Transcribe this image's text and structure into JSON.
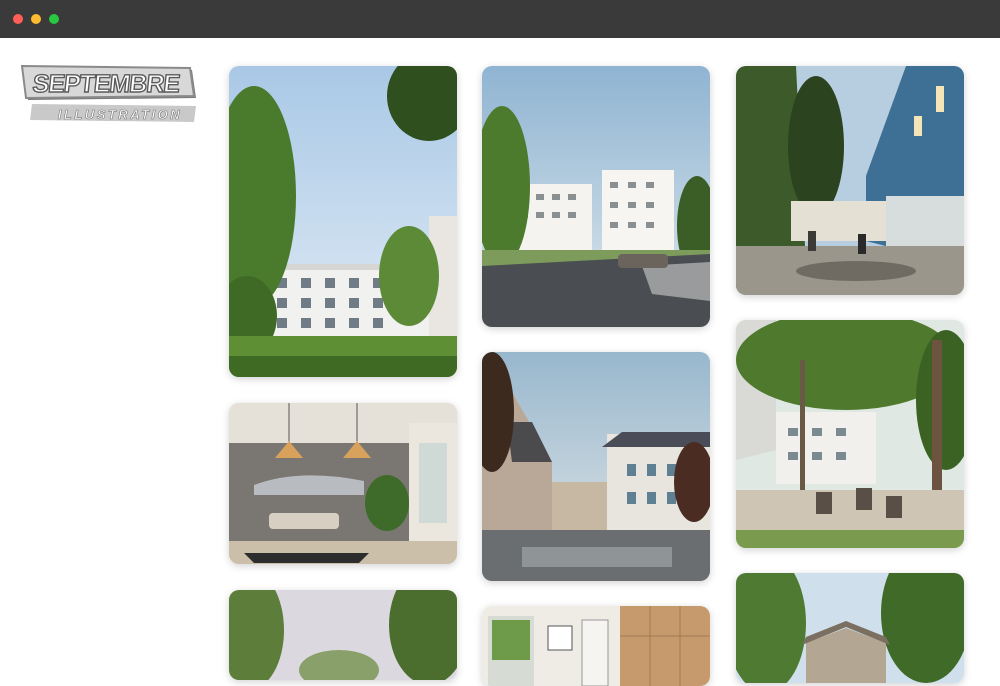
{
  "window": {
    "controls": [
      "close",
      "minimize",
      "maximize"
    ]
  },
  "logo": {
    "title": "SEPTEMBRE",
    "subtitle": "ILLUSTRATION"
  },
  "gallery": {
    "items": [
      {
        "subject": "white apartment building behind trees and lawn"
      },
      {
        "subject": "white residential blocks with street and parked car"
      },
      {
        "subject": "courtyard with blue house, string lights and people seated"
      },
      {
        "subject": "interior living room with car on wall and pendant lamps"
      },
      {
        "subject": "wet square with old town houses at dusk"
      },
      {
        "subject": "garden terrace under large trees with chairs"
      },
      {
        "subject": "trees and sky landscape"
      },
      {
        "subject": "interior with wooden cabinets and window"
      },
      {
        "subject": "wooden house among trees"
      }
    ]
  }
}
